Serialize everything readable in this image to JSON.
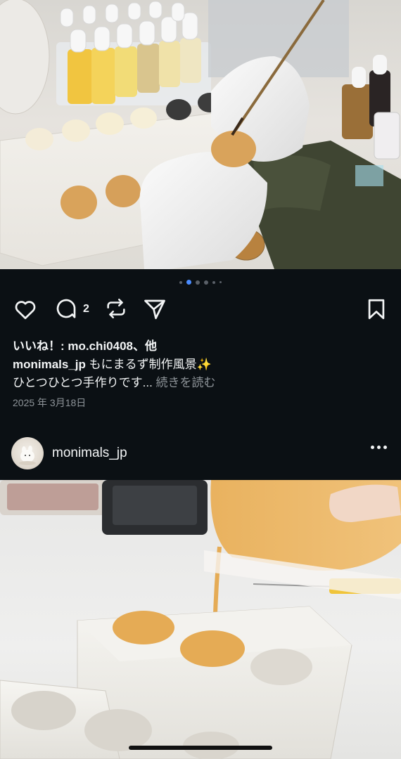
{
  "post": {
    "comment_count": "2",
    "likes_text": "いいね！: mo.chi0408、他",
    "caption_user": "monimals_jp",
    "caption_text": "もにまるず制作風景✨",
    "caption_line2": "ひとつひとつ手作りです...",
    "more_label": "続きを読む",
    "date": "2025 年 3月18日"
  },
  "carousel": {
    "count": 6,
    "active_index": 1
  },
  "next_post": {
    "username": "monimals_jp"
  },
  "colors": {
    "background": "#0b1014",
    "active_dot": "#4a8cff",
    "muted_text": "#8e9499"
  }
}
